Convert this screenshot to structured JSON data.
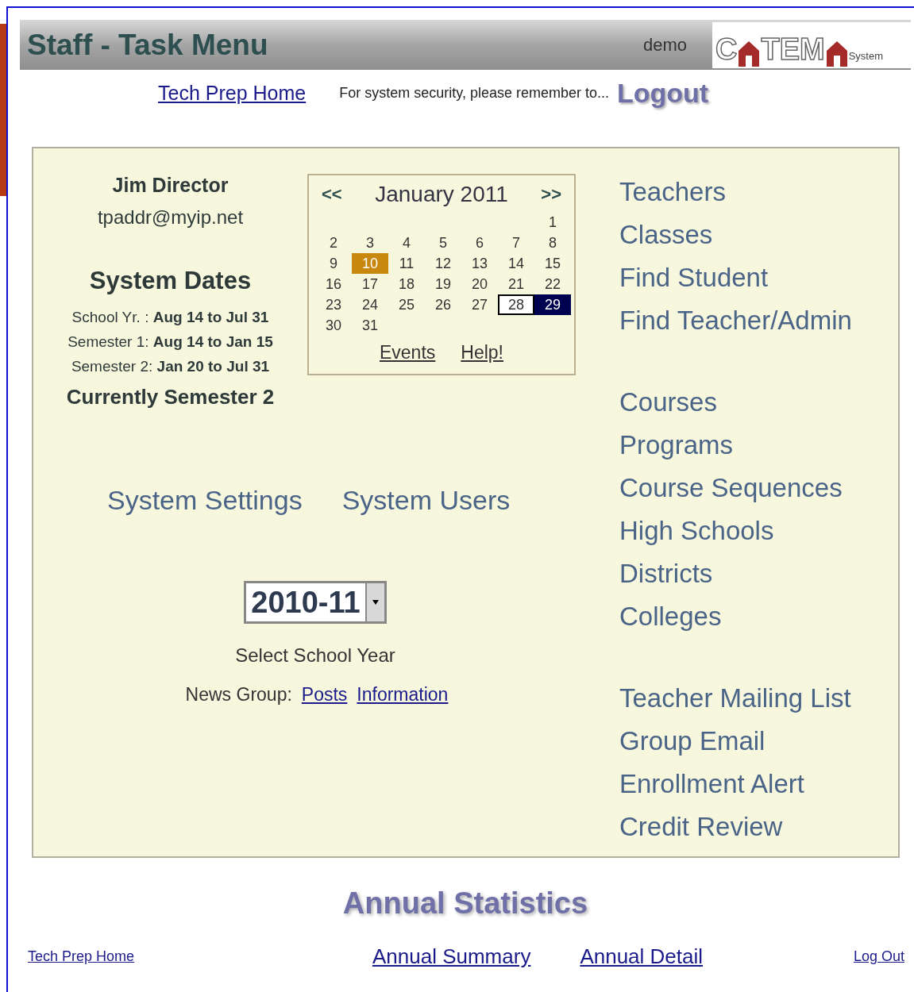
{
  "header": {
    "title": "Staff - Task Menu",
    "user": "demo",
    "logo": {
      "text_1": "C",
      "text_2": "TEM",
      "text_3": "System"
    }
  },
  "top_links": {
    "home": "Tech Prep Home",
    "notice": "For system security, please remember to...",
    "logout": "Logout"
  },
  "profile": {
    "name": "Jim Director",
    "email": "tpaddr@myip.net"
  },
  "system_dates": {
    "title": "System Dates",
    "rows": [
      {
        "label": "School Yr. :",
        "value": "Aug 14 to Jul 31"
      },
      {
        "label": "Semester 1:",
        "value": "Aug 14 to Jan 15"
      },
      {
        "label": "Semester 2:",
        "value": "Jan 20 to Jul 31"
      }
    ],
    "current": "Currently Semester 2"
  },
  "calendar": {
    "prev": "<<",
    "month": "January 2011",
    "next": ">>",
    "weeks": [
      {
        "kind": "start",
        "days": [
          {
            "label": "1",
            "selected": false,
            "today": false,
            "boxed": false
          }
        ]
      },
      {
        "kind": "full",
        "days": [
          {
            "label": "2",
            "selected": false,
            "today": false,
            "boxed": false
          },
          {
            "label": "3",
            "selected": false,
            "today": false,
            "boxed": false
          },
          {
            "label": "4",
            "selected": false,
            "today": false,
            "boxed": false
          },
          {
            "label": "5",
            "selected": false,
            "today": false,
            "boxed": false
          },
          {
            "label": "6",
            "selected": false,
            "today": false,
            "boxed": false
          },
          {
            "label": "7",
            "selected": false,
            "today": false,
            "boxed": false
          },
          {
            "label": "8",
            "selected": false,
            "today": false,
            "boxed": false
          }
        ]
      },
      {
        "kind": "full",
        "days": [
          {
            "label": "9",
            "selected": false,
            "today": false,
            "boxed": false
          },
          {
            "label": "10",
            "selected": false,
            "today": true,
            "boxed": false
          },
          {
            "label": "11",
            "selected": false,
            "today": false,
            "boxed": false
          },
          {
            "label": "12",
            "selected": false,
            "today": false,
            "boxed": false
          },
          {
            "label": "13",
            "selected": false,
            "today": false,
            "boxed": false
          },
          {
            "label": "14",
            "selected": false,
            "today": false,
            "boxed": false
          },
          {
            "label": "15",
            "selected": false,
            "today": false,
            "boxed": false
          }
        ]
      },
      {
        "kind": "full",
        "days": [
          {
            "label": "16",
            "selected": false,
            "today": false,
            "boxed": false
          },
          {
            "label": "17",
            "selected": false,
            "today": false,
            "boxed": false
          },
          {
            "label": "18",
            "selected": false,
            "today": false,
            "boxed": false
          },
          {
            "label": "19",
            "selected": false,
            "today": false,
            "boxed": false
          },
          {
            "label": "20",
            "selected": false,
            "today": false,
            "boxed": false
          },
          {
            "label": "21",
            "selected": false,
            "today": false,
            "boxed": false
          },
          {
            "label": "22",
            "selected": false,
            "today": false,
            "boxed": false
          }
        ]
      },
      {
        "kind": "full",
        "days": [
          {
            "label": "23",
            "selected": false,
            "today": false,
            "boxed": false
          },
          {
            "label": "24",
            "selected": false,
            "today": false,
            "boxed": false
          },
          {
            "label": "25",
            "selected": false,
            "today": false,
            "boxed": false
          },
          {
            "label": "26",
            "selected": false,
            "today": false,
            "boxed": false
          },
          {
            "label": "27",
            "selected": false,
            "today": false,
            "boxed": false
          },
          {
            "label": "28",
            "selected": false,
            "today": false,
            "boxed": true
          },
          {
            "label": "29",
            "selected": true,
            "today": false,
            "boxed": false
          }
        ]
      },
      {
        "kind": "end",
        "days": [
          {
            "label": "30",
            "selected": false,
            "today": false,
            "boxed": false
          },
          {
            "label": "31",
            "selected": false,
            "today": false,
            "boxed": false
          }
        ]
      }
    ],
    "links": [
      "Events",
      "Help!"
    ]
  },
  "system_links": [
    "System Settings",
    "System Users"
  ],
  "school_year": {
    "value": "2010-11",
    "label": "Select School Year"
  },
  "news_group": {
    "label": "News Group:",
    "links": [
      "Posts",
      "Information"
    ]
  },
  "nav_groups": [
    [
      "Teachers",
      "Classes",
      "Find Student",
      "Find Teacher/Admin"
    ],
    [
      "Courses",
      "Programs",
      "Course Sequences",
      "High Schools",
      "Districts",
      "Colleges"
    ],
    [
      "Teacher Mailing List",
      "Group Email",
      "Enrollment Alert",
      "Credit Review"
    ]
  ],
  "annual_statistics": {
    "title": "Annual Statistics",
    "links": [
      "Annual Summary",
      "Annual Detail"
    ]
  },
  "footer": {
    "home": "Tech Prep Home",
    "logout": "Log Out"
  }
}
